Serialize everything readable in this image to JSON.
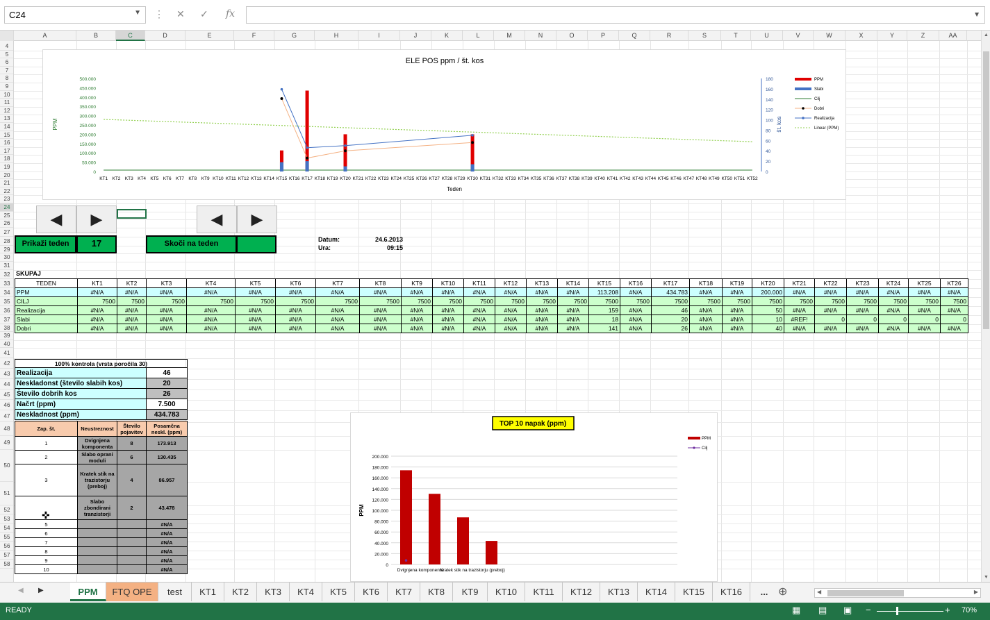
{
  "formula_bar": {
    "name_box": "C24",
    "fx": "fx"
  },
  "columns": [
    "A",
    "B",
    "C",
    "D",
    "E",
    "F",
    "G",
    "H",
    "I",
    "J",
    "K",
    "L",
    "M",
    "N",
    "O",
    "P",
    "Q",
    "R",
    "S",
    "T",
    "U",
    "V",
    "W",
    "X",
    "Y",
    "Z",
    "AA"
  ],
  "selected_column": "C",
  "selected_row": "24",
  "chart1": {
    "title": "ELE POS ppm / št. kos",
    "xlabel": "Teden",
    "ylabel_left": "PPM",
    "ylabel_right": "št. kos",
    "y_left_ticks": [
      "500.000",
      "450.000",
      "400.000",
      "350.000",
      "300.000",
      "250.000",
      "200.000",
      "150.000",
      "100.000",
      "50.000",
      "0"
    ],
    "y_right_ticks": [
      "180",
      "160",
      "140",
      "120",
      "100",
      "80",
      "60",
      "40",
      "20",
      "0"
    ],
    "legend": [
      "PPM",
      "Slabi",
      "Cilj",
      "Dobri",
      "Realizacija",
      "Linear (PPM)"
    ],
    "colors": {
      "ppm": "#e00000",
      "slabi": "#4472c4",
      "cilj": "#2e7d32",
      "dobri": "#000000",
      "realizacija": "#4472c4",
      "linear": "#92d050"
    }
  },
  "chart_data": [
    {
      "type": "bar",
      "title": "ELE POS ppm / št. kos",
      "xlabel": "Teden",
      "ylabel": "PPM",
      "ylim": [
        0,
        500000
      ],
      "y2lim": [
        0,
        180
      ],
      "categories": [
        "KT1",
        "KT2",
        "KT3",
        "KT4",
        "KT5",
        "KT6",
        "KT7",
        "KT8",
        "KT9",
        "KT10",
        "KT11",
        "KT12",
        "KT13",
        "KT14",
        "KT15",
        "KT16",
        "KT17",
        "KT18",
        "KT19",
        "KT20",
        "KT21",
        "KT22",
        "KT23",
        "KT24",
        "KT25",
        "KT26",
        "KT27",
        "KT28",
        "KT29",
        "KT30",
        "KT31",
        "KT32",
        "KT33",
        "KT34",
        "KT35",
        "KT36",
        "KT37",
        "KT38",
        "KT39",
        "KT40",
        "KT41",
        "KT42",
        "KT43",
        "KT44",
        "KT45",
        "KT46",
        "KT47",
        "KT48",
        "KT49",
        "KT50",
        "KT51",
        "KT52"
      ],
      "series": [
        {
          "name": "PPM",
          "axis": "left",
          "type": "bar",
          "points": [
            [
              "KT15",
              113208
            ],
            [
              "KT17",
              434783
            ],
            [
              "KT20",
              200000
            ],
            [
              "KT30",
              200000
            ]
          ]
        },
        {
          "name": "Slabi",
          "axis": "right",
          "type": "bar",
          "points": [
            [
              "KT15",
              18
            ],
            [
              "KT17",
              20
            ],
            [
              "KT20",
              10
            ],
            [
              "KT30",
              14
            ]
          ]
        },
        {
          "name": "Cilj",
          "axis": "left",
          "type": "line",
          "points": [
            [
              "KT1",
              7500
            ],
            [
              "KT52",
              7500
            ]
          ]
        },
        {
          "name": "Dobri",
          "axis": "right",
          "type": "line",
          "points": [
            [
              "KT15",
              141
            ],
            [
              "KT17",
              26
            ],
            [
              "KT20",
              40
            ],
            [
              "KT30",
              56
            ]
          ]
        },
        {
          "name": "Realizacija",
          "axis": "right",
          "type": "line",
          "points": [
            [
              "KT15",
              159
            ],
            [
              "KT17",
              46
            ],
            [
              "KT20",
              50
            ],
            [
              "KT30",
              70
            ]
          ]
        },
        {
          "name": "Linear (PPM)",
          "axis": "left",
          "type": "trend",
          "points": [
            [
              "KT1",
              280000
            ],
            [
              "KT52",
              160000
            ]
          ]
        }
      ]
    },
    {
      "type": "bar",
      "title": "TOP 10 napak (ppm)",
      "ylabel": "PPM",
      "ylim": [
        0,
        200000
      ],
      "y_ticks": [
        "200.000",
        "180.000",
        "160.000",
        "140.000",
        "120.000",
        "100.000",
        "80.000",
        "60.000",
        "40.000",
        "20.000",
        "0"
      ],
      "categories": [
        "Dvignjena komponenta",
        "Slabo oprani moduli",
        "Kratek stik na trazistorju (preboj)",
        "Slabo zbondirani tranzistorji"
      ],
      "x_tick_labels": [
        "Dvignjena komponenta",
        "Kratek stik na trazistorju (preboj)"
      ],
      "series": [
        {
          "name": "PPM",
          "values": [
            173913,
            130435,
            86957,
            43478
          ]
        },
        {
          "name": "Cilj",
          "values": [
            7500,
            null,
            null,
            null
          ]
        }
      ],
      "legend": [
        "PPM",
        "Cilj"
      ]
    }
  ],
  "nav": {
    "prikazi_label": "Prikaži teden",
    "prikazi_value": "17",
    "skoci_label": "Skoči na teden",
    "skoci_value": "",
    "left_arrow": "◀",
    "right_arrow": "▶"
  },
  "info": {
    "datum_label": "Datum:",
    "datum_value": "24.6.2013",
    "ura_label": "Ura:",
    "ura_value": "09:15"
  },
  "skupaj": {
    "title": "SKUPAJ",
    "header": [
      "TEDEN",
      "KT1",
      "KT2",
      "KT3",
      "KT4",
      "KT5",
      "KT6",
      "KT7",
      "KT8",
      "KT9",
      "KT10",
      "KT11",
      "KT12",
      "KT13",
      "KT14",
      "KT15",
      "KT16",
      "KT17",
      "KT18",
      "KT19",
      "KT20",
      "KT21",
      "KT22",
      "KT23",
      "KT24",
      "KT25",
      "KT26"
    ],
    "rows": [
      [
        "PPM",
        "#N/A",
        "#N/A",
        "#N/A",
        "#N/A",
        "#N/A",
        "#N/A",
        "#N/A",
        "#N/A",
        "#N/A",
        "#N/A",
        "#N/A",
        "#N/A",
        "#N/A",
        "#N/A",
        "113.208",
        "#N/A",
        "434.783",
        "#N/A",
        "#N/A",
        "200.000",
        "#N/A",
        "#N/A",
        "#N/A",
        "#N/A",
        "#N/A",
        "#N/A"
      ],
      [
        "CILJ",
        "7500",
        "7500",
        "7500",
        "7500",
        "7500",
        "7500",
        "7500",
        "7500",
        "7500",
        "7500",
        "7500",
        "7500",
        "7500",
        "7500",
        "7500",
        "7500",
        "7500",
        "7500",
        "7500",
        "7500",
        "7500",
        "7500",
        "7500",
        "7500",
        "7500",
        "7500"
      ],
      [
        "Realizacija",
        "#N/A",
        "#N/A",
        "#N/A",
        "#N/A",
        "#N/A",
        "#N/A",
        "#N/A",
        "#N/A",
        "#N/A",
        "#N/A",
        "#N/A",
        "#N/A",
        "#N/A",
        "#N/A",
        "159",
        "#N/A",
        "46",
        "#N/A",
        "#N/A",
        "50",
        "#N/A",
        "#N/A",
        "#N/A",
        "#N/A",
        "#N/A",
        "#N/A"
      ],
      [
        "Slabi",
        "#N/A",
        "#N/A",
        "#N/A",
        "#N/A",
        "#N/A",
        "#N/A",
        "#N/A",
        "#N/A",
        "#N/A",
        "#N/A",
        "#N/A",
        "#N/A",
        "#N/A",
        "#N/A",
        "18",
        "#N/A",
        "20",
        "#N/A",
        "#N/A",
        "10",
        "#REF!",
        "0",
        "0",
        "0",
        "0",
        "0"
      ],
      [
        "Dobri",
        "#N/A",
        "#N/A",
        "#N/A",
        "#N/A",
        "#N/A",
        "#N/A",
        "#N/A",
        "#N/A",
        "#N/A",
        "#N/A",
        "#N/A",
        "#N/A",
        "#N/A",
        "#N/A",
        "141",
        "#N/A",
        "26",
        "#N/A",
        "#N/A",
        "40",
        "#N/A",
        "#N/A",
        "#N/A",
        "#N/A",
        "#N/A",
        "#N/A"
      ]
    ]
  },
  "kontrola": {
    "title": "100% kontrola (vrsta poročila 30)",
    "rows": [
      [
        "Realizacija",
        "46"
      ],
      [
        "Neskladonst (število slabih kos)",
        "20"
      ],
      [
        "Število dobrih kos",
        "26"
      ],
      [
        "Načrt (ppm)",
        "7.500"
      ],
      [
        "Neskladnost (ppm)",
        "434.783"
      ]
    ]
  },
  "napake": {
    "header": [
      "Zap. št.",
      "Neustreznost",
      "Število pojavitev",
      "Posamčna neskl. (ppm)"
    ],
    "rows": [
      [
        "1",
        "Dvignjena komponenta",
        "8",
        "173.913"
      ],
      [
        "2",
        "Slabo oprani moduli",
        "6",
        "130.435"
      ],
      [
        "3",
        "Kratek stik na trazistorju (preboj)",
        "4",
        "86.957"
      ],
      [
        "",
        "Slabo zbondirani tranzistorji",
        "2",
        "43.478"
      ],
      [
        "5",
        "",
        "",
        "#N/A"
      ],
      [
        "6",
        "",
        "",
        "#N/A"
      ],
      [
        "7",
        "",
        "",
        "#N/A"
      ],
      [
        "8",
        "",
        "",
        "#N/A"
      ],
      [
        "9",
        "",
        "",
        "#N/A"
      ],
      [
        "10",
        "",
        "",
        "#N/A"
      ]
    ]
  },
  "tabs": [
    "PPM",
    "FTQ OPE",
    "test",
    "KT1",
    "KT2",
    "KT3",
    "KT4",
    "KT5",
    "KT6",
    "KT7",
    "KT8",
    "KT9",
    "KT10",
    "KT11",
    "KT12",
    "KT13",
    "KT14",
    "KT15",
    "KT16",
    "..."
  ],
  "status": {
    "ready": "READY",
    "zoom": "70%"
  }
}
